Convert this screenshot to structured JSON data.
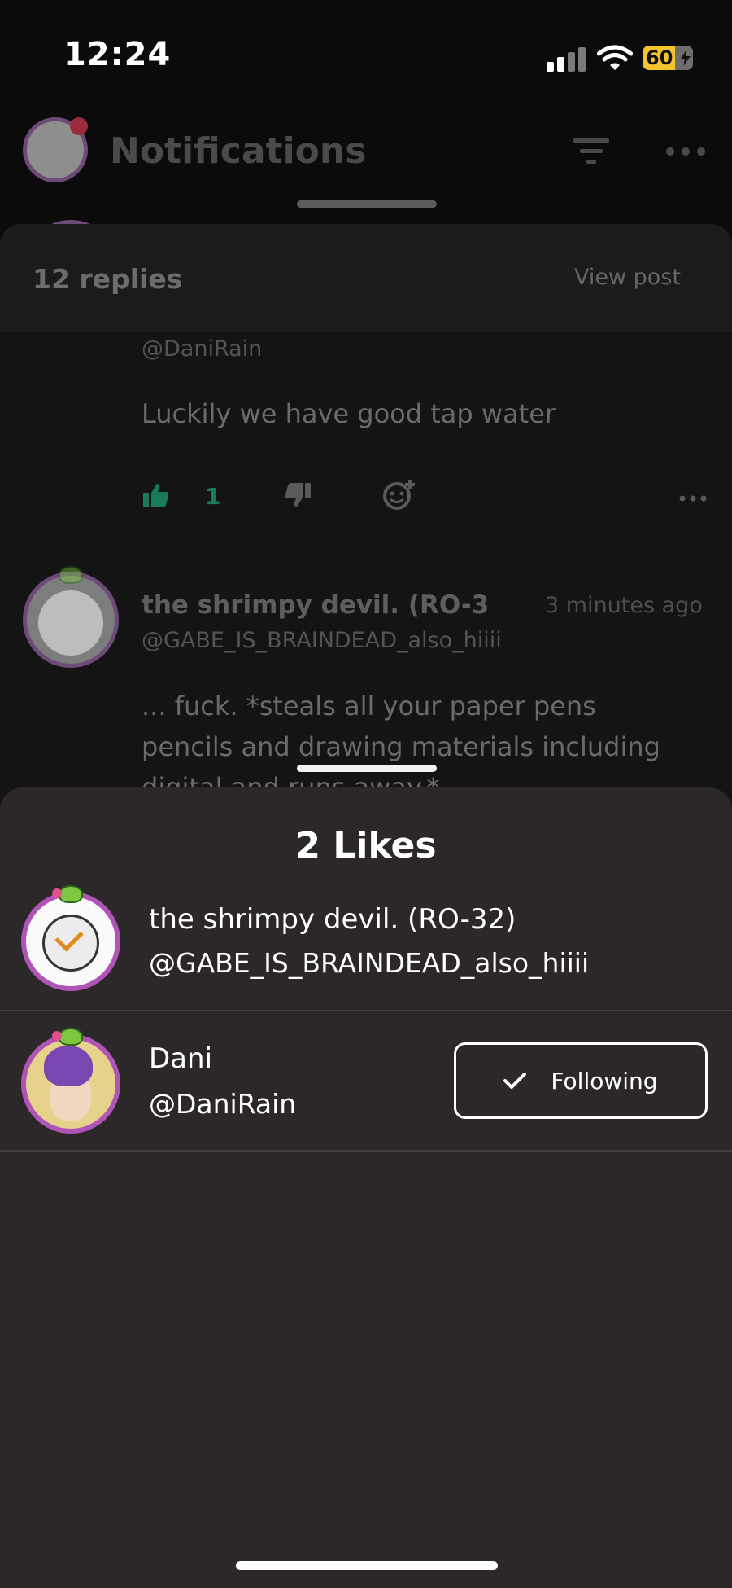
{
  "status_bar": {
    "time": "12:24",
    "battery": "60"
  },
  "header": {
    "title": "Notifications"
  },
  "replies": {
    "count_label": "12 replies",
    "view_post_label": "View post",
    "items": [
      {
        "handle": "@DaniRain",
        "text": "Luckily we have good tap water",
        "like_count": "1"
      },
      {
        "name": "the shrimpy devil.     (RO-3",
        "time": "3 minutes ago",
        "handle": "@GABE_IS_BRAINDEAD_also_hiiii",
        "text_line1": "... fuck. *steals all your paper pens",
        "text_line2": "pencils and drawing materials including",
        "text_line3": "digital and runs away.*"
      }
    ]
  },
  "likes_sheet": {
    "title": "2 Likes",
    "users": [
      {
        "name": "the shrimpy devil.     (RO-32)",
        "handle": "@GABE_IS_BRAINDEAD_also_hiiii"
      },
      {
        "name": "Dani",
        "handle": "@DaniRain",
        "follow_label": "Following"
      }
    ]
  },
  "colors": {
    "like_green": "#1a7a5c",
    "sheet_bg": "#2c2728",
    "avatar_ring": "#b054b8",
    "battery": "#f4c430"
  }
}
